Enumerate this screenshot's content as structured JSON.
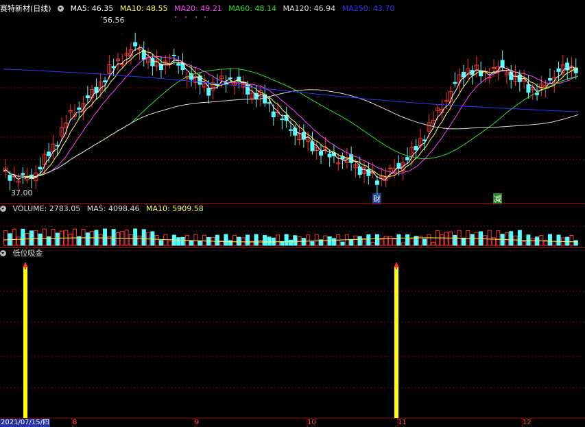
{
  "stock": {
    "name": "赛特新材",
    "period": "(日线)"
  },
  "ma_legend": [
    {
      "label": "MA5: 46.35",
      "color": "#ffffff"
    },
    {
      "label": "MA10: 48.55",
      "color": "#ffff55"
    },
    {
      "label": "MA20: 49.21",
      "color": "#ff44ff"
    },
    {
      "label": "MA60: 48.14",
      "color": "#33dd33"
    },
    {
      "label": "MA120: 46.94",
      "color": "#dddddd"
    },
    {
      "label": "MA250: 43.70",
      "color": "#3333ff"
    }
  ],
  "price_marks": {
    "high": "56.56",
    "low": "37.00"
  },
  "events": {
    "cai": "财",
    "jian": "减"
  },
  "volume_legend": [
    {
      "label": "VOLUME: 2783.05",
      "color": "#dddddd"
    },
    {
      "label": "MA5: 4098.46",
      "color": "#dddddd"
    },
    {
      "label": "MA10: 5909.58",
      "color": "#ffff55"
    }
  ],
  "indicator": {
    "name": "低位吸金",
    "signal_color": "#ffff00"
  },
  "date_axis": {
    "current": "2021/07/15/四",
    "months": [
      "8",
      "9",
      "10",
      "11",
      "12"
    ]
  },
  "colors": {
    "up": "#ff3232",
    "down": "#54ffff",
    "grid": "#8b0000",
    "bg": "#000000"
  }
}
